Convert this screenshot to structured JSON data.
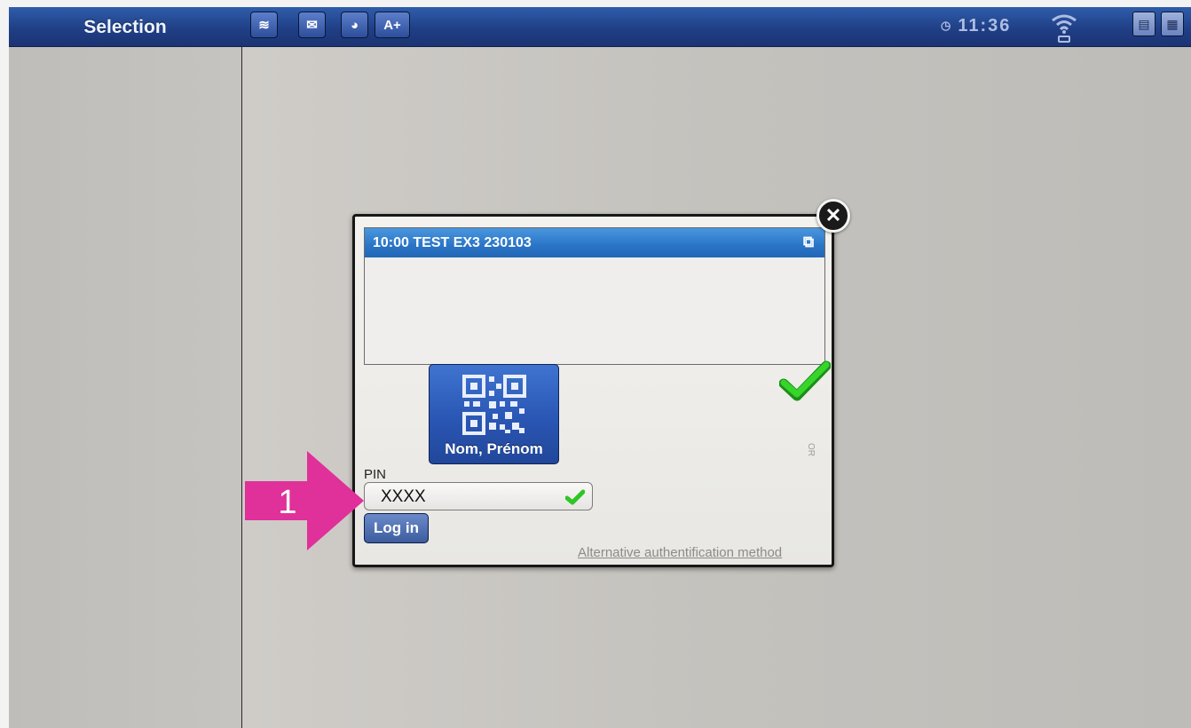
{
  "topbar": {
    "title": "Selection",
    "buttons": [
      {
        "name": "layers-icon",
        "glyph": "≋"
      },
      {
        "name": "mail-icon",
        "glyph": "✉"
      },
      {
        "name": "globe-icon",
        "glyph": "◕"
      },
      {
        "name": "font-size-button",
        "label": "A+"
      }
    ],
    "time": "11:36",
    "right_icons": [
      "document-icon",
      "grid-icon"
    ]
  },
  "dialog": {
    "header_title": "10:00 TEST EX3 230103",
    "header_icon": "copy-check-icon",
    "qr_button_label": "Nom, Prénom",
    "side_text": "OR",
    "pin_label": "PIN",
    "pin_value": "XXXX",
    "login_label": "Log in",
    "alt_link": "Alternative authentification method",
    "close_icon": "close-icon"
  },
  "annotation": {
    "number": "1",
    "color": "#e0309a"
  },
  "colors": {
    "topbar": "#203f86",
    "header_blue": "#2a74c6",
    "check_green": "#28c81f"
  }
}
